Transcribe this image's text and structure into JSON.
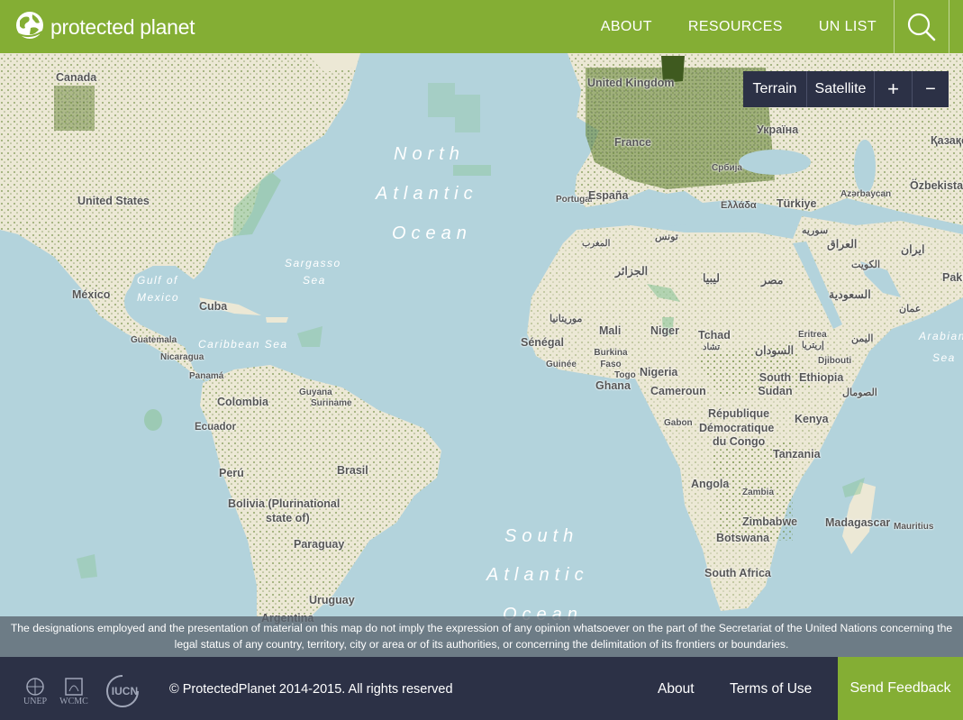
{
  "header": {
    "brand": "protected planet",
    "nav": [
      {
        "label": "ABOUT"
      },
      {
        "label": "RESOURCES"
      },
      {
        "label": "UN LIST"
      }
    ]
  },
  "map_controls": {
    "terrain": "Terrain",
    "satellite": "Satellite",
    "zoom_in": "+",
    "zoom_out": "−"
  },
  "map_labels": {
    "countries": [
      "Canada",
      "United States",
      "México",
      "Cuba",
      "Guatemala",
      "Nicaragua",
      "Panamá",
      "Colombia",
      "Ecuador",
      "Perú",
      "Brasil",
      "Bolivia (Plurinational",
      "state of)",
      "Paraguay",
      "Uruguay",
      "Argentina",
      "Guyana",
      "Suriname",
      "United Kingdom",
      "France",
      "Portugal",
      "España",
      "Україна",
      "Қазақстан",
      "Türkiye",
      "Ελλάδα",
      "Србија",
      "Azərbaycan",
      "Özbekistan",
      "ایران",
      "العراق",
      "سوريه",
      "الكويت",
      "السعودية",
      "عمان",
      "Pakistan",
      "تونس",
      "الجزائر",
      "ليبيا",
      "مصر",
      "المغرب",
      "موريتانيا",
      "Mali",
      "Niger",
      "Tchad",
      "تشاد",
      "السودان",
      "Eritrea",
      "إريتريا",
      "اليمن",
      "Djibouti",
      "الصومال",
      "Ethiopia",
      "South Sudan",
      "Sénégal",
      "Guinée",
      "Burkina Faso",
      "Togo",
      "Ghana",
      "Nigeria",
      "Cameroun",
      "Gabon",
      "République",
      "Démocratique",
      "du Congo",
      "Kenya",
      "Tanzania",
      "Angola",
      "Zambia",
      "Zimbabwe",
      "Botswana",
      "Madagascar",
      "Mauritius",
      "South Africa"
    ],
    "seas": [
      "North",
      "Atlantic",
      "Ocean",
      "South",
      "Atlantic",
      "Ocean",
      "Gulf of",
      "Mexico",
      "Caribbean Sea",
      "Sargasso",
      "Sea",
      "Arabian",
      "Sea"
    ]
  },
  "disclaimer": "The designations employed and the presentation of material on this map do not imply the expression of any opinion whatsoever on the part of the Secretariat of the United Nations concerning the legal status of any country, territory, city or area or of its authorities, or concerning the delimitation of its frontiers or boundaries.",
  "footer": {
    "logos": [
      "UNEP",
      "WCMC",
      "IUCN"
    ],
    "copyright": "© ProtectedPlanet 2014-2015. All rights reserved",
    "links": [
      "About",
      "Terms of Use"
    ],
    "feedback": "Send Feedback"
  },
  "colors": {
    "brand_green": "#84ae34",
    "dark_navy": "#2c3146",
    "ocean": "#b3d3dc",
    "land": "#ece8d5",
    "protected_area": "#4f6b2a"
  }
}
